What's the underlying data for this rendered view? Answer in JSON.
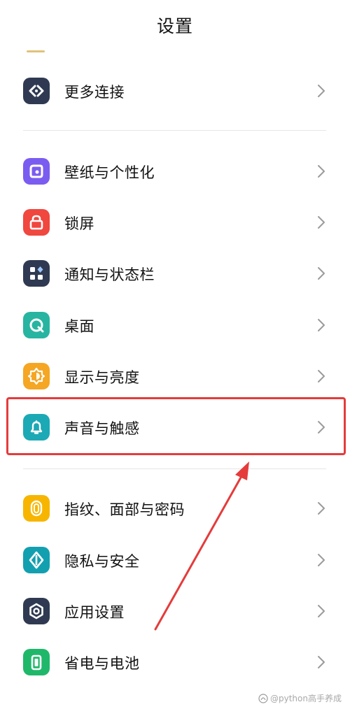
{
  "header": {
    "title": "设置"
  },
  "sections": [
    {
      "items": [
        {
          "id": "more-connect",
          "label": "更多连接",
          "icon": "link-icon",
          "icon_color": "#2f3a52"
        }
      ]
    },
    {
      "items": [
        {
          "id": "wallpaper",
          "label": "壁纸与个性化",
          "icon": "theme-icon",
          "icon_color": "#7b5cf0"
        },
        {
          "id": "lockscreen",
          "label": "锁屏",
          "icon": "lock-icon",
          "icon_color": "#f0473f"
        },
        {
          "id": "notifications",
          "label": "通知与状态栏",
          "icon": "grid-icon",
          "icon_color": "#2f3a52"
        },
        {
          "id": "desktop",
          "label": "桌面",
          "icon": "home-icon",
          "icon_color": "#27b5a1"
        },
        {
          "id": "display",
          "label": "显示与亮度",
          "icon": "brightness-icon",
          "icon_color": "#f5a623"
        },
        {
          "id": "sound",
          "label": "声音与触感",
          "icon": "bell-icon",
          "icon_color": "#1ba9b5"
        }
      ]
    },
    {
      "items": [
        {
          "id": "fingerprint",
          "label": "指纹、面部与密码",
          "icon": "fingerprint-icon",
          "icon_color": "#f7b500"
        },
        {
          "id": "privacy",
          "label": "隐私与安全",
          "icon": "shield-icon",
          "icon_color": "#12a0b0"
        },
        {
          "id": "apps",
          "label": "应用设置",
          "icon": "gear-icon",
          "icon_color": "#2f3a52"
        },
        {
          "id": "battery",
          "label": "省电与电池",
          "icon": "battery-icon",
          "icon_color": "#1fb86a"
        }
      ]
    }
  ],
  "annotation": {
    "highlight_color": "#e53b3b"
  },
  "watermark": {
    "text": "@python高手养成"
  }
}
